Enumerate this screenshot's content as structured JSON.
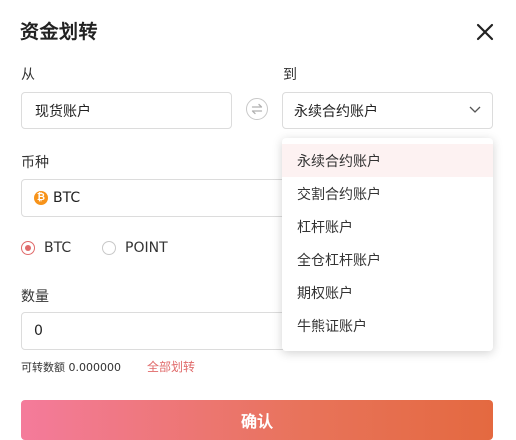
{
  "dialog": {
    "title": "资金划转",
    "close_icon": "close-icon"
  },
  "from": {
    "label": "从",
    "value": "现货账户"
  },
  "to": {
    "label": "到",
    "value": "永续合约账户"
  },
  "swap_icon": "swap-arrows-icon",
  "currency": {
    "label": "币种",
    "value": "BTC",
    "icon": "bitcoin-icon",
    "icon_color": "#f7931a"
  },
  "radios": [
    {
      "label": "BTC",
      "selected": true
    },
    {
      "label": "POINT",
      "selected": false
    }
  ],
  "amount": {
    "label": "数量",
    "value": "0"
  },
  "available": {
    "label": "可转数额 0.000000",
    "transfer_all": "全部划转"
  },
  "dropdown_options": [
    {
      "label": "永续合约账户",
      "active": true
    },
    {
      "label": "交割合约账户",
      "active": false
    },
    {
      "label": "杠杆账户",
      "active": false
    },
    {
      "label": "全仓杠杆账户",
      "active": false
    },
    {
      "label": "期权账户",
      "active": false
    },
    {
      "label": "牛熊证账户",
      "active": false
    }
  ],
  "confirm_label": "确认",
  "colors": {
    "accent": "#e06a6a",
    "link": "#e06a6a",
    "button_gradient_start": "#f47b9b",
    "button_gradient_end": "#e46940"
  }
}
